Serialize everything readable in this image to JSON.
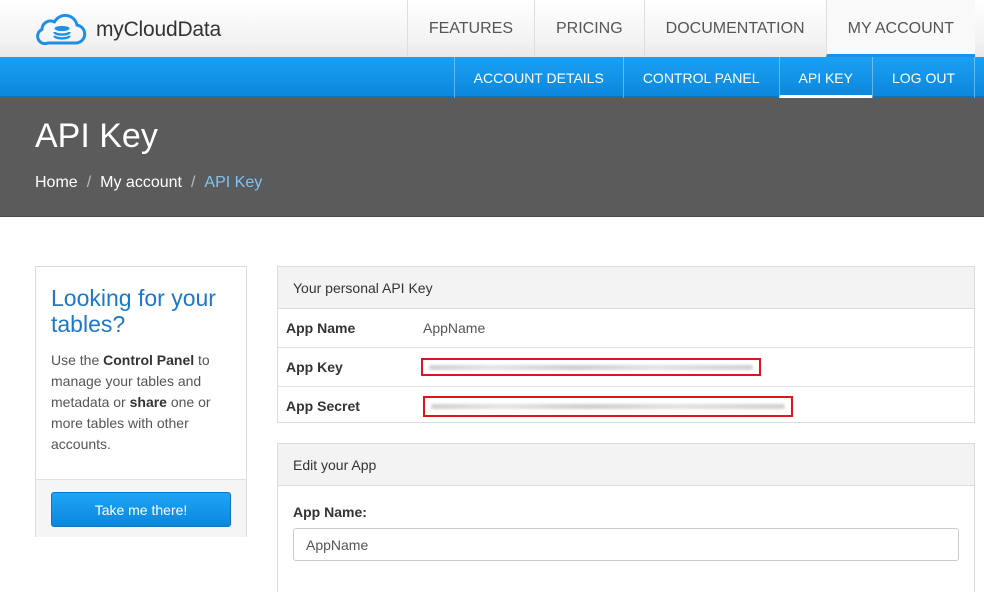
{
  "header": {
    "logo_text": "myCloudData",
    "nav": [
      "FEATURES",
      "PRICING",
      "DOCUMENTATION",
      "MY ACCOUNT"
    ],
    "active_nav": "MY ACCOUNT"
  },
  "subnav": {
    "items": [
      "ACCOUNT DETAILS",
      "CONTROL PANEL",
      "API KEY",
      "LOG OUT"
    ],
    "active": "API KEY"
  },
  "page": {
    "title": "API Key",
    "breadcrumb": [
      "Home",
      "My account",
      "API Key"
    ]
  },
  "sidebar": {
    "title": "Looking for your tables?",
    "text_1": "Use the ",
    "text_bold_1": "Control Panel",
    "text_2": " to manage your tables and metadata or ",
    "text_bold_2": "share",
    "text_3": " one or more tables with other accounts.",
    "button": "Take me there!"
  },
  "api_panel": {
    "heading": "Your personal API Key",
    "rows": [
      {
        "label": "App Name",
        "value": "AppName"
      },
      {
        "label": "App Key",
        "value": ""
      },
      {
        "label": "App Secret",
        "value": ""
      }
    ]
  },
  "edit_panel": {
    "heading": "Edit your App",
    "field_label": "App Name:",
    "field_value": "AppName"
  },
  "colors": {
    "accent": "#1a9af0",
    "header_bg": "#5b5b5b",
    "redaction_border": "#e0141b",
    "link_active": "#7fc4f5"
  },
  "icons": [
    "cloud-database-logo-icon"
  ]
}
